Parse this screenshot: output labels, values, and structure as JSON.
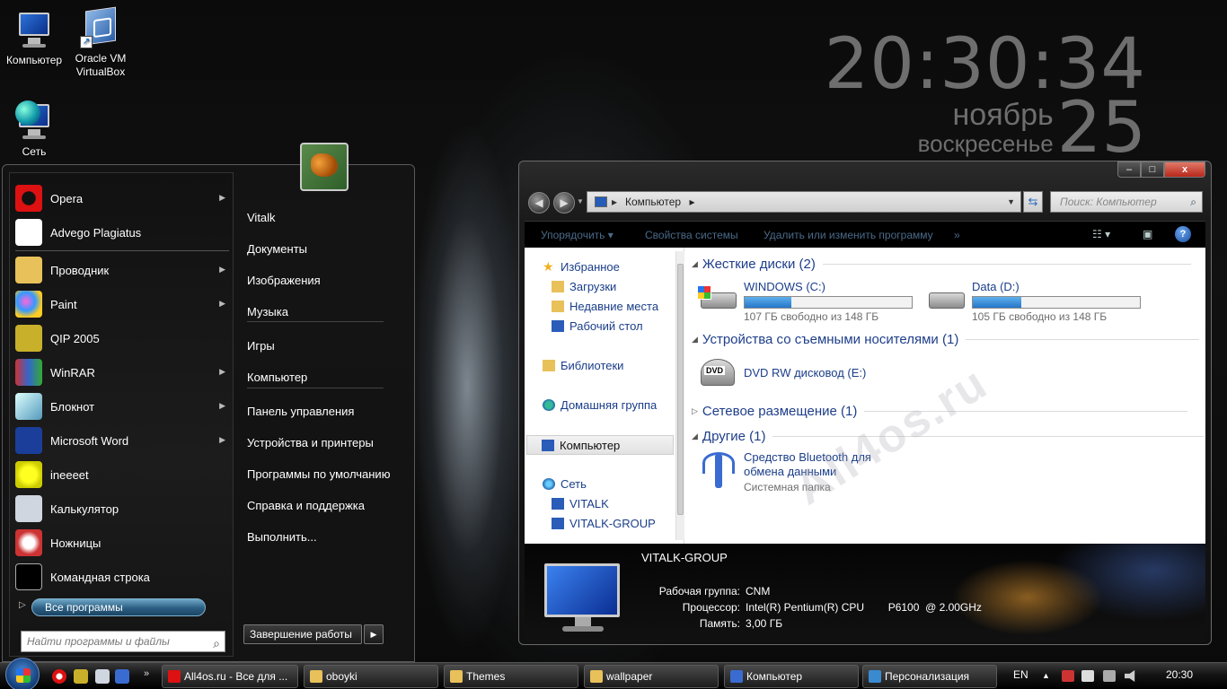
{
  "desktop": {
    "icons": [
      {
        "label": "Компьютер"
      },
      {
        "label": "Oracle VM VirtualBox"
      },
      {
        "label": "Сеть"
      }
    ]
  },
  "clock": {
    "time": "20:30:34",
    "month": "ноябрь",
    "weekday": "воскресенье",
    "day": "25"
  },
  "start_menu": {
    "programs": [
      {
        "label": "Opera",
        "icon": "opera-icon",
        "has_submenu": true
      },
      {
        "label": "Advego Plagiatus",
        "icon": "advego-icon",
        "has_submenu": false
      },
      {
        "label": "Проводник",
        "icon": "explorer-icon",
        "has_submenu": true
      },
      {
        "label": "Paint",
        "icon": "paint-icon",
        "has_submenu": true
      },
      {
        "label": "QIP 2005",
        "icon": "qip-icon",
        "has_submenu": false
      },
      {
        "label": "WinRAR",
        "icon": "winrar-icon",
        "has_submenu": true
      },
      {
        "label": "Блокнот",
        "icon": "notepad-icon",
        "has_submenu": true
      },
      {
        "label": "Microsoft Word",
        "icon": "word-icon",
        "has_submenu": true
      },
      {
        "label": "ineeeet",
        "icon": "star-icon",
        "has_submenu": false
      },
      {
        "label": "Калькулятор",
        "icon": "calculator-icon",
        "has_submenu": false
      },
      {
        "label": "Ножницы",
        "icon": "scissors-icon",
        "has_submenu": false
      },
      {
        "label": "Командная строка",
        "icon": "cmd-icon",
        "has_submenu": false
      }
    ],
    "all_programs": "Все программы",
    "search_placeholder": "Найти программы и файлы",
    "right_items": [
      "Vitalk",
      "Документы",
      "Изображения",
      "Музыка",
      "Игры",
      "Компьютер",
      "Панель управления",
      "Устройства и принтеры",
      "Программы по умолчанию",
      "Справка и поддержка",
      "Выполнить..."
    ],
    "shutdown": "Завершение работы"
  },
  "explorer": {
    "address": "Компьютер",
    "search_placeholder": "Поиск: Компьютер",
    "commands": [
      "Упорядочить",
      "Свойства системы",
      "Удалить или изменить программу",
      "»"
    ],
    "nav": {
      "favorites": "Избранное",
      "downloads": "Загрузки",
      "recent": "Недавние места",
      "desktop": "Рабочий стол",
      "libraries": "Библиотеки",
      "homegroup": "Домашняя группа",
      "computer": "Компьютер",
      "network": "Сеть",
      "net1": "VITALK",
      "net2": "VITALK-GROUP"
    },
    "groups": {
      "hdd": "Жесткие диски (2)",
      "removable": "Устройства со съемными носителями (1)",
      "netloc": "Сетевое размещение (1)",
      "other": "Другие (1)"
    },
    "drives": [
      {
        "name": "WINDOWS (C:)",
        "free": "107 ГБ свободно из 148 ГБ",
        "used_fraction": 0.28
      },
      {
        "name": "Data (D:)",
        "free": "105 ГБ свободно из 148 ГБ",
        "used_fraction": 0.29
      }
    ],
    "dvd": {
      "name": "DVD RW дисковод (E:)",
      "badge": "DVD"
    },
    "bluetooth": {
      "name_line1": "Средство Bluetooth для",
      "name_line2": "обмена данными",
      "type": "Системная папка"
    },
    "watermark": "All4os.ru",
    "details": {
      "name": "VITALK-GROUP",
      "workgroup_label": "Рабочая группа:",
      "workgroup": "CNM",
      "cpu_label": "Процессор:",
      "cpu": "Intel(R) Pentium(R) CPU        P6100  @ 2.00GHz",
      "ram_label": "Память:",
      "ram": "3,00 ГБ"
    },
    "window_buttons": {
      "minimize": "–",
      "maximize": "□",
      "close": "x"
    }
  },
  "taskbar": {
    "items": [
      {
        "label": "All4os.ru - Все для ...",
        "color": "#d11"
      },
      {
        "label": "oboyki",
        "color": "#e8c15a"
      },
      {
        "label": "Themes",
        "color": "#e8c15a"
      },
      {
        "label": "wallpaper",
        "color": "#e8c15a"
      },
      {
        "label": "Компьютер",
        "color": "#3a6bd0"
      },
      {
        "label": "Персонализация",
        "color": "#3a8ad0"
      }
    ],
    "lang": "EN",
    "clock": "20:30"
  }
}
